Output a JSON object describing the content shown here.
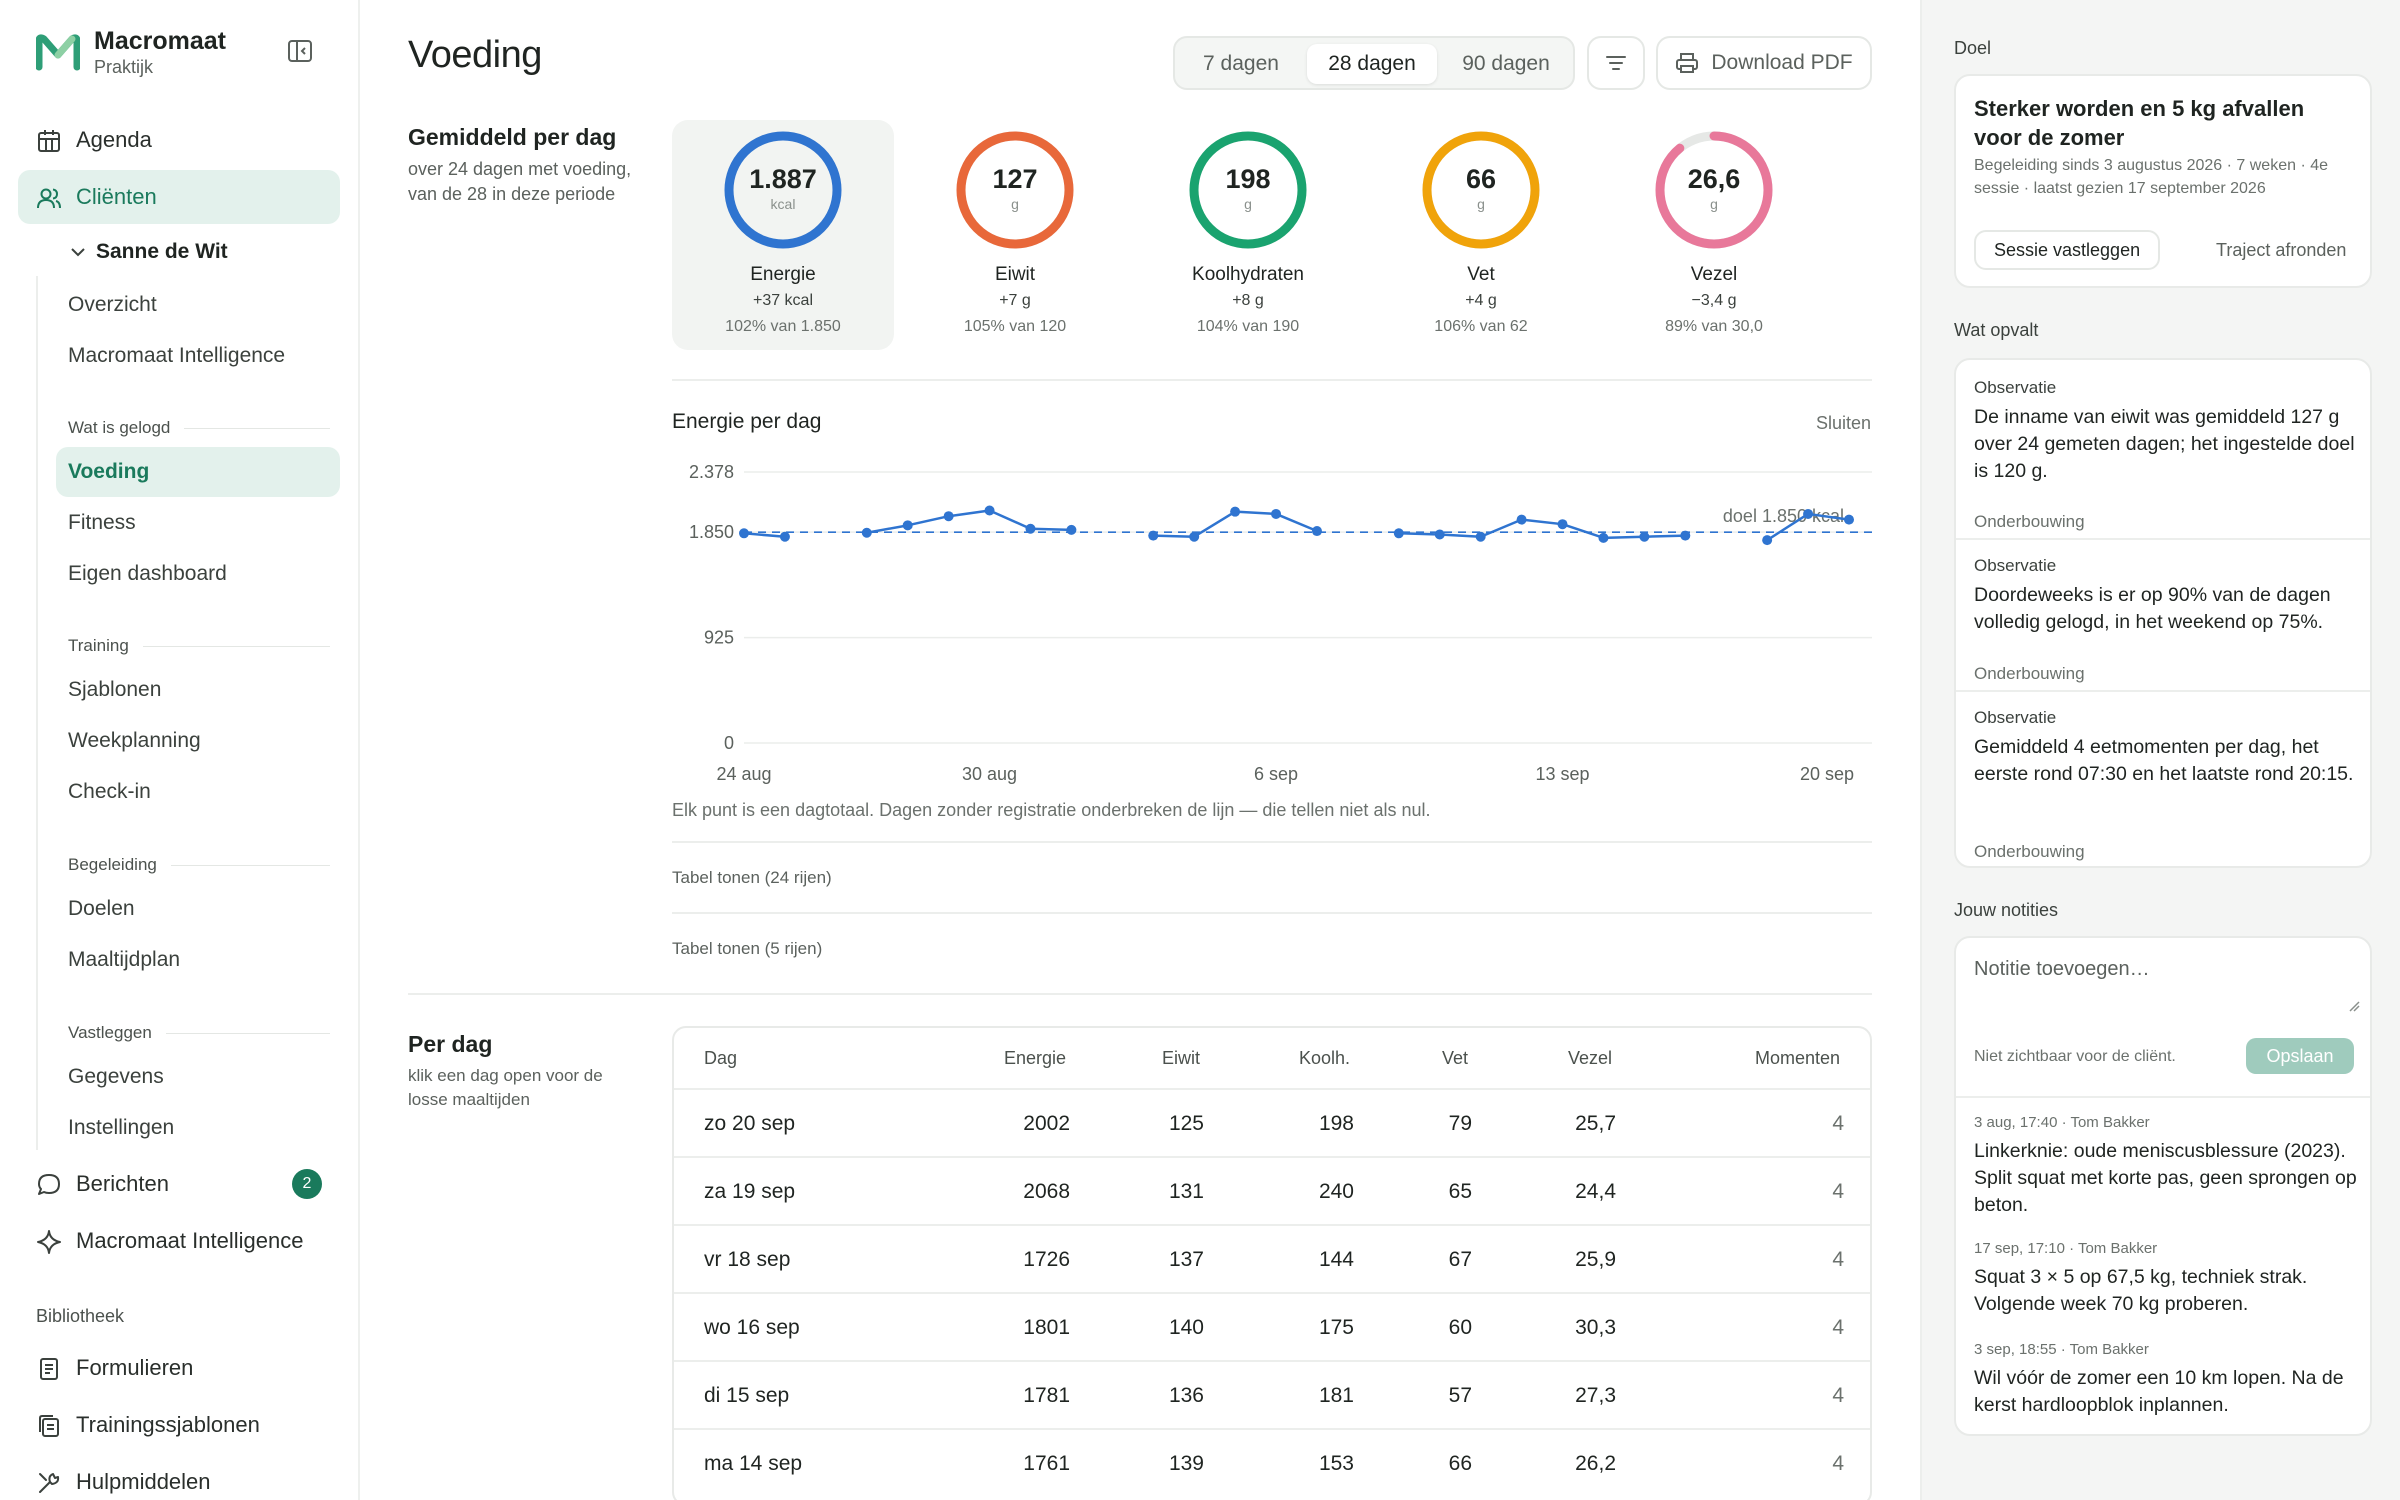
{
  "app": {
    "name": "Macromaat",
    "subtitle": "Praktijk"
  },
  "nav": {
    "agenda": "Agenda",
    "clients": "Cliënten",
    "client_name": "Sanne de Wit",
    "overview": "Overzicht",
    "intelligence": "Macromaat Intelligence",
    "group_logged": "Wat is gelogd",
    "nutrition": "Voeding",
    "fitness": "Fitness",
    "dashboard": "Eigen dashboard",
    "group_training": "Training",
    "templates": "Sjablonen",
    "week_planning": "Weekplanning",
    "checkin": "Check-in",
    "group_guidance": "Begeleiding",
    "goals": "Doelen",
    "meal_plan": "Maaltijdplan",
    "group_record": "Vastleggen",
    "data": "Gegevens",
    "settings": "Instellingen",
    "messages": "Berichten",
    "messages_badge": "2",
    "intelligence_main": "Macromaat Intelligence",
    "library": "Bibliotheek",
    "forms": "Formulieren",
    "training_templates": "Trainingssjablonen",
    "resources": "Hulpmiddelen"
  },
  "header": {
    "title": "Voeding",
    "ranges": [
      "7 dagen",
      "28 dagen",
      "90 dagen"
    ],
    "active_range": "28 dagen",
    "download": "Download PDF"
  },
  "summary": {
    "title": "Gemiddeld per dag",
    "subtitle": "over 24 dagen met voeding, van de 28 in deze periode",
    "macros": [
      {
        "value": "1.887",
        "unit": "kcal",
        "name": "Energie",
        "delta": "+37 kcal",
        "pct": "102% van 1.850",
        "fraction": 1.0,
        "color": "#2f74d0"
      },
      {
        "value": "127",
        "unit": "g",
        "name": "Eiwit",
        "delta": "+7 g",
        "pct": "105% van 120",
        "fraction": 1.0,
        "color": "#e8683a"
      },
      {
        "value": "198",
        "unit": "g",
        "name": "Koolhydraten",
        "delta": "+8 g",
        "pct": "104% van 190",
        "fraction": 1.0,
        "color": "#1aa36f"
      },
      {
        "value": "66",
        "unit": "g",
        "name": "Vet",
        "delta": "+4 g",
        "pct": "106% van 62",
        "fraction": 1.0,
        "color": "#f0a30a"
      },
      {
        "value": "26,6",
        "unit": "g",
        "name": "Vezel",
        "delta": "−3,4 g",
        "pct": "89% van 30,0",
        "fraction": 0.89,
        "color": "#e8789a"
      }
    ]
  },
  "energy_chart": {
    "title": "Energie per dag",
    "close": "Sluiten",
    "note": "Elk punt is een dagtotaal. Dagen zonder registratie onderbreken de lijn — die tellen niet als nul.",
    "goal_label": "doel 1.850 kcal",
    "table_toggle_1": "Tabel tonen (24 rijen)",
    "table_toggle_2": "Tabel tonen (5 rijen)"
  },
  "chart_data": {
    "type": "line",
    "title": "Energie per dag",
    "x_ticks": [
      "24 aug",
      "30 aug",
      "6 sep",
      "13 sep",
      "20 sep"
    ],
    "y_ticks": [
      "2.378",
      "1.850",
      "925",
      "0"
    ],
    "ylim": [
      0,
      2378
    ],
    "goal": 1850,
    "x_days": [
      "24 aug",
      "25 aug",
      "26 aug",
      "27 aug",
      "28 aug",
      "29 aug",
      "30 aug",
      "31 aug",
      "1 sep",
      "2 sep",
      "3 sep",
      "4 sep",
      "5 sep",
      "6 sep",
      "7 sep",
      "8 sep",
      "9 sep",
      "10 sep",
      "11 sep",
      "12 sep",
      "13 sep",
      "14 sep",
      "15 sep",
      "16 sep",
      "17 sep",
      "18 sep",
      "19 sep",
      "20 sep"
    ],
    "values": [
      1840,
      1810,
      null,
      1845,
      1910,
      1990,
      2040,
      1880,
      1870,
      null,
      1820,
      1810,
      2030,
      2010,
      1860,
      null,
      1840,
      1830,
      1810,
      1960,
      1920,
      1800,
      1810,
      1820,
      null,
      1780,
      2010,
      1960
    ],
    "grid": true
  },
  "per_day": {
    "title": "Per dag",
    "subtitle": "klik een dag open voor de losse maaltijden",
    "headers": [
      "Dag",
      "Energie",
      "Eiwit",
      "Koolh.",
      "Vet",
      "Vezel",
      "Momenten"
    ],
    "rows": [
      [
        "zo 20 sep",
        "2002",
        "125",
        "198",
        "79",
        "25,7",
        "4"
      ],
      [
        "za 19 sep",
        "2068",
        "131",
        "240",
        "65",
        "24,4",
        "4"
      ],
      [
        "vr 18 sep",
        "1726",
        "137",
        "144",
        "67",
        "25,9",
        "4"
      ],
      [
        "wo 16 sep",
        "1801",
        "140",
        "175",
        "60",
        "30,3",
        "4"
      ],
      [
        "di 15 sep",
        "1781",
        "136",
        "181",
        "57",
        "27,3",
        "4"
      ],
      [
        "ma 14 sep",
        "1761",
        "139",
        "153",
        "66",
        "26,2",
        "4"
      ]
    ]
  },
  "right": {
    "goal_label": "Doel",
    "goal_title": "Sterker worden en 5 kg afvallen voor de zomer",
    "goal_meta": "Begeleiding sinds 3 augustus 2026 · 7 weken · 4e sessie · laatst gezien 17 september 2026",
    "record_session": "Sessie vastleggen",
    "finish_track": "Traject afronden",
    "notice_label": "Wat opvalt",
    "observations": [
      {
        "kicker": "Observatie",
        "text": "De inname van eiwit was gemiddeld 127 g over 24 gemeten dagen; het ingestelde doel is 120 g.",
        "link": "Onderbouwing"
      },
      {
        "kicker": "Observatie",
        "text": "Doordeweeks is er op 90% van de dagen volledig gelogd, in het weekend op 75%.",
        "link": "Onderbouwing"
      },
      {
        "kicker": "Observatie",
        "text": "Gemiddeld 4 eetmomenten per dag, het eerste rond 07:30 en het laatste rond 20:15.",
        "link": "Onderbouwing"
      }
    ],
    "notes_label": "Jouw notities",
    "note_placeholder": "Notitie toevoegen…",
    "note_hint": "Niet zichtbaar voor de cliënt.",
    "save": "Opslaan",
    "notes": [
      {
        "meta": "3 aug, 17:40 · Tom Bakker",
        "text": "Linkerknie: oude meniscusblessure (2023). Split squat met korte pas, geen sprongen op beton."
      },
      {
        "meta": "17 sep, 17:10 · Tom Bakker",
        "text": "Squat 3 × 5 op 67,5 kg, techniek strak. Volgende week 70 kg proberen."
      },
      {
        "meta": "3 sep, 18:55 · Tom Bakker",
        "text": "Wil vóór de zomer een 10 km lopen. Na de kerst hardloopblok inplannen."
      }
    ]
  },
  "colors": {
    "accent": "#1a7a5c",
    "accent_bg": "#e3f1ec",
    "chart_line": "#2f74d0"
  }
}
